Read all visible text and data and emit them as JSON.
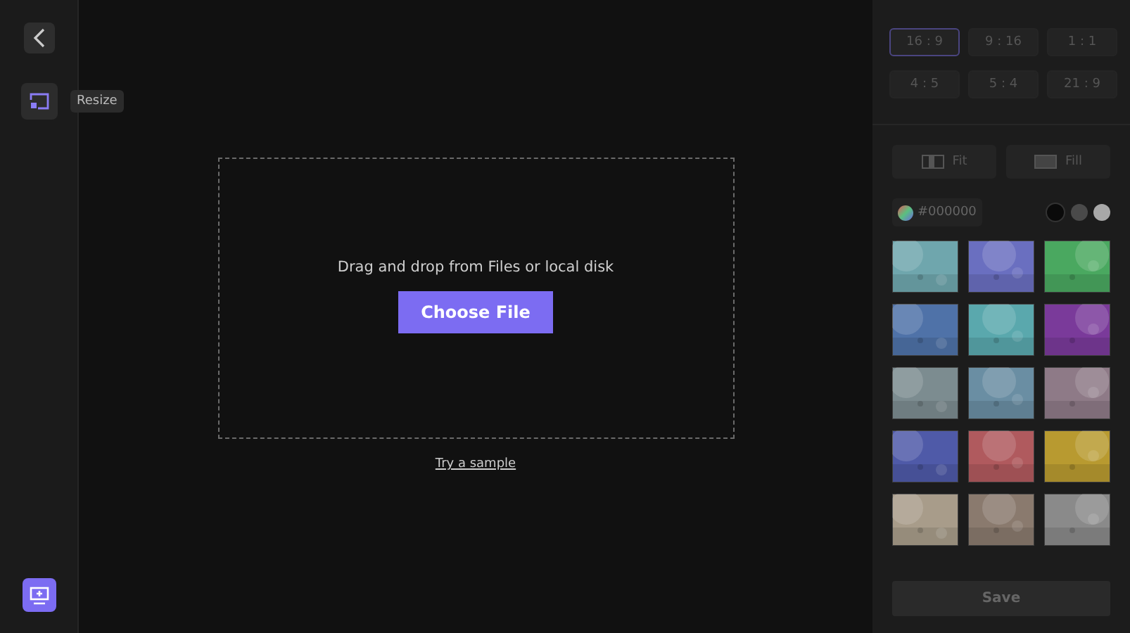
{
  "sidebar": {
    "tools": [
      {
        "kind": "resize",
        "selected": true,
        "tooltip": "Resize"
      }
    ]
  },
  "dropzone": {
    "hint": "Drag and drop from Files or local disk",
    "button": "Choose File",
    "link": "Try a sample"
  },
  "ratios": [
    {
      "label": "16 : 9",
      "selected": true
    },
    {
      "label": "9 : 16",
      "selected": false
    },
    {
      "label": "1 : 1",
      "selected": false
    },
    {
      "label": "4 : 5",
      "selected": false
    },
    {
      "label": "5 : 4",
      "selected": false
    },
    {
      "label": "21 : 9",
      "selected": false
    }
  ],
  "fit_modes": [
    {
      "kind": "fit",
      "label": "Fit"
    },
    {
      "kind": "fill",
      "label": "Fill"
    }
  ],
  "color_field": {
    "value": "#000000"
  },
  "color_presets": [
    {
      "color": "#0a0a0a",
      "selected": true
    },
    {
      "color": "#4a4a4a",
      "selected": false
    },
    {
      "color": "#a8a8a8",
      "selected": false
    }
  ],
  "save_button": {
    "label": "Save",
    "disabled": true
  }
}
